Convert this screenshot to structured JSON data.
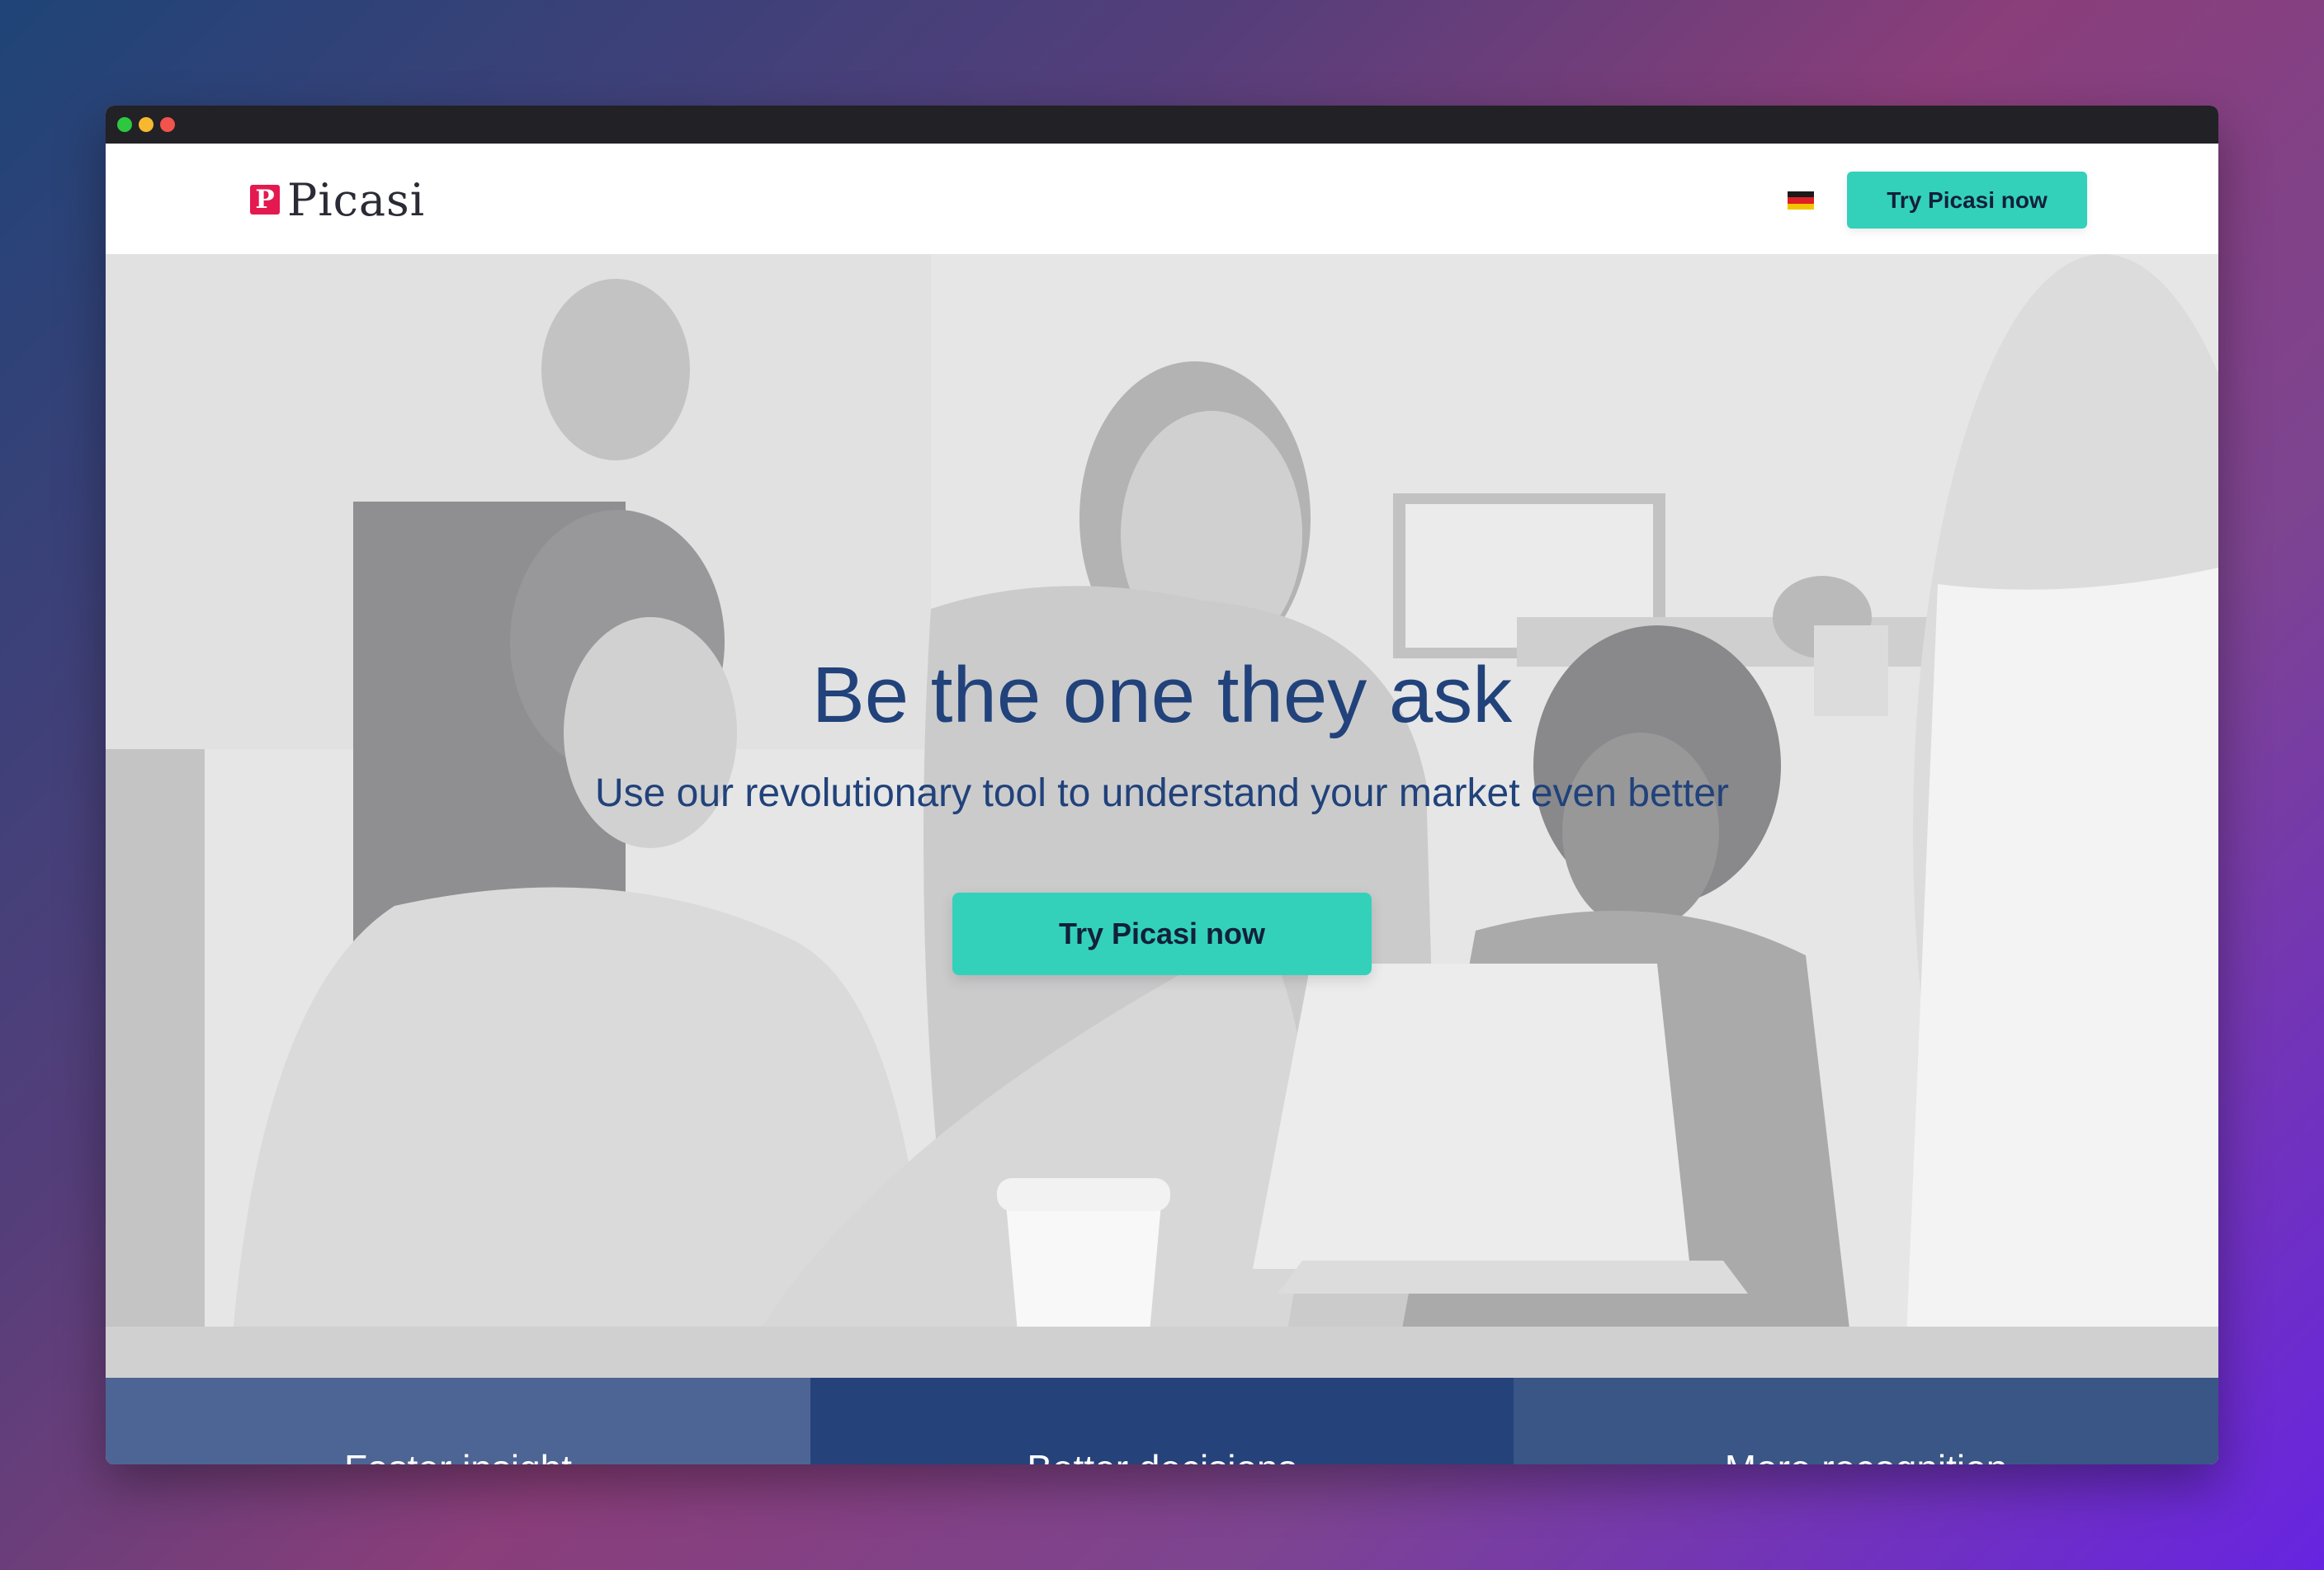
{
  "header": {
    "logo_mark": "P",
    "logo_text": "Picasi",
    "language_flag": "flag-germany",
    "cta_label": "Try Picasi now"
  },
  "hero": {
    "title": "Be the one they ask",
    "subtitle": "Use our revolutionary tool to understand your market even better",
    "cta_label": "Try Picasi now"
  },
  "features": [
    {
      "title": "Faster insight"
    },
    {
      "title": "Better decisions"
    },
    {
      "title": "More recognition"
    }
  ],
  "colors": {
    "accent": "#33d1ba",
    "brand": "#e4194f",
    "text_primary": "#21427a",
    "feature_1": "#4d6594",
    "feature_2": "#25427a",
    "feature_3": "#3a5686"
  }
}
